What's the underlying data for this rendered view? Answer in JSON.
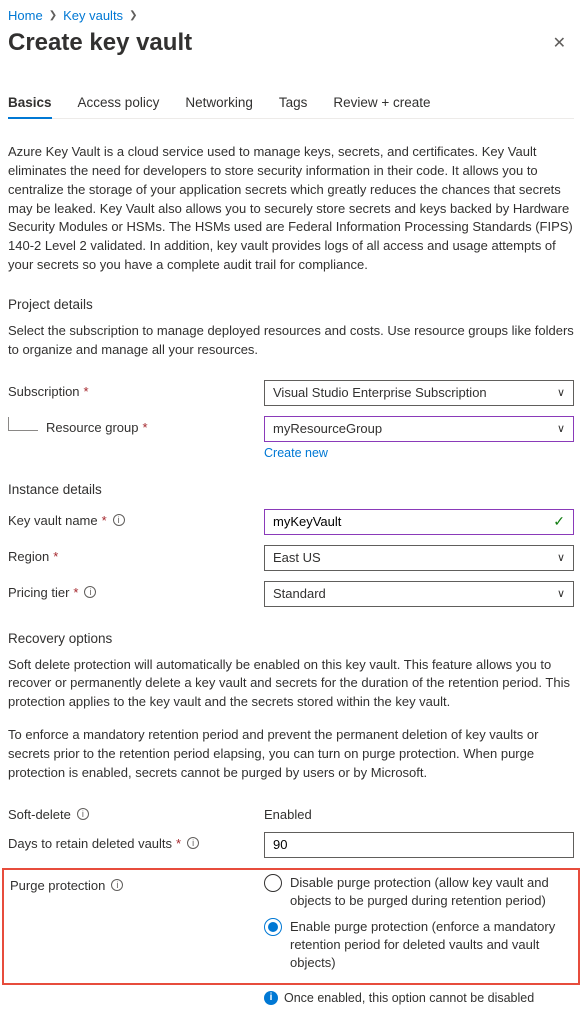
{
  "breadcrumb": {
    "home": "Home",
    "keyvaults": "Key vaults"
  },
  "title": "Create key vault",
  "tabs": {
    "basics": "Basics",
    "access": "Access policy",
    "networking": "Networking",
    "tags": "Tags",
    "review": "Review + create"
  },
  "intro": "Azure Key Vault is a cloud service used to manage keys, secrets, and certificates. Key Vault eliminates the need for developers to store security information in their code. It allows you to centralize the storage of your application secrets which greatly reduces the chances that secrets may be leaked. Key Vault also allows you to securely store secrets and keys backed by Hardware Security Modules or HSMs. The HSMs used are Federal Information Processing Standards (FIPS) 140-2 Level 2 validated. In addition, key vault provides logs of all access and usage attempts of your secrets so you have a complete audit trail for compliance.",
  "project": {
    "heading": "Project details",
    "desc": "Select the subscription to manage deployed resources and costs. Use resource groups like folders to organize and manage all your resources.",
    "subscription_label": "Subscription",
    "subscription_value": "Visual Studio Enterprise Subscription",
    "rg_label": "Resource group",
    "rg_value": "myResourceGroup",
    "create_new": "Create new"
  },
  "instance": {
    "heading": "Instance details",
    "name_label": "Key vault name",
    "name_value": "myKeyVault",
    "region_label": "Region",
    "region_value": "East US",
    "tier_label": "Pricing tier",
    "tier_value": "Standard"
  },
  "recovery": {
    "heading": "Recovery options",
    "desc1": "Soft delete protection will automatically be enabled on this key vault. This feature allows you to recover or permanently delete a key vault and secrets for the duration of the retention period. This protection applies to the key vault and the secrets stored within the key vault.",
    "desc2": "To enforce a mandatory retention period and prevent the permanent deletion of key vaults or secrets prior to the retention period elapsing, you can turn on purge protection. When purge protection is enabled, secrets cannot be purged by users or by Microsoft.",
    "softdelete_label": "Soft-delete",
    "softdelete_value": "Enabled",
    "days_label": "Days to retain deleted vaults",
    "days_value": "90",
    "purge_label": "Purge protection",
    "purge_opt1": "Disable purge protection (allow key vault and objects to be purged during retention period)",
    "purge_opt2": "Enable purge protection (enforce a mandatory retention period for deleted vaults and vault objects)",
    "note": "Once enabled, this option cannot be disabled"
  }
}
